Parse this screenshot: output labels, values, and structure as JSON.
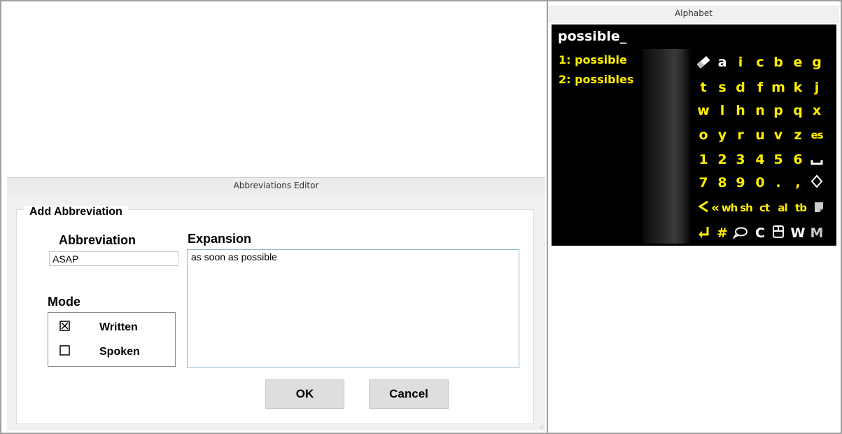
{
  "alphabet_window": {
    "title": "Alphabet",
    "typed_text": "possible_",
    "predictions": [
      {
        "label": "1: possible"
      },
      {
        "label": "2: possibles"
      }
    ],
    "keyboard": {
      "rows": [
        [
          "eraser-icon",
          "a",
          "i",
          "c",
          "b",
          "e",
          "g"
        ],
        [
          "t",
          "s",
          "d",
          "f",
          "m",
          "k",
          "j"
        ],
        [
          "w",
          "l",
          "h",
          "n",
          "p",
          "q",
          "x"
        ],
        [
          "o",
          "y",
          "r",
          "u",
          "v",
          "z",
          "es"
        ],
        [
          "1",
          "2",
          "3",
          "4",
          "5",
          "6",
          "space-icon"
        ],
        [
          "7",
          "8",
          "9",
          "0",
          ".",
          ",",
          "diamond-icon"
        ],
        [
          "back-icon",
          "«",
          "wh",
          "sh",
          "ct",
          "al",
          "tb",
          "note-icon"
        ],
        [
          "enter-icon",
          "#",
          "speech-bubble-icon",
          "C",
          "window-icon",
          "W",
          "M"
        ]
      ]
    }
  },
  "abbreviations_editor": {
    "title": "Abbreviations Editor",
    "group_title": "Add Abbreviation",
    "abbreviation_label": "Abbreviation",
    "abbreviation_value": "ASAP",
    "expansion_label": "Expansion",
    "expansion_value": "as soon as possible",
    "mode_label": "Mode",
    "modes": [
      {
        "label": "Written",
        "checked": true
      },
      {
        "label": "Spoken",
        "checked": false
      }
    ],
    "ok_label": "OK",
    "cancel_label": "Cancel"
  }
}
